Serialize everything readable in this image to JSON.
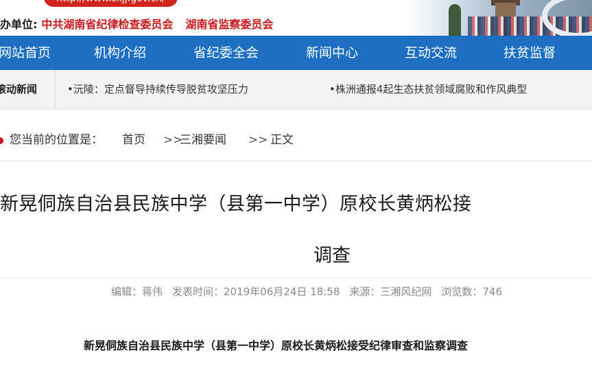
{
  "header": {
    "url": "http://www.sxjj.gov.cn/",
    "sponsor_label": "办单位:",
    "org_1": "中共湖南省纪律检查委员会",
    "org_2": "湖南省监察委员会"
  },
  "nav": {
    "items": [
      {
        "label": "网站首页"
      },
      {
        "label": "机构介绍"
      },
      {
        "label": "省纪委全会"
      },
      {
        "label": "新闻中心"
      },
      {
        "label": "互动交流"
      },
      {
        "label": "扶贫监督"
      }
    ]
  },
  "ticker": {
    "label": "滚动新闻",
    "items": [
      {
        "text": "•沅陵：定点督导持续传导脱贫攻坚压力"
      },
      {
        "text": "•株洲通报4起生态扶贫领域腐败和作风典型"
      }
    ]
  },
  "breadcrumb": {
    "prefix": "您当前的位置是：",
    "home": "首页",
    "sep": ">>",
    "section": "三湘要闻",
    "current": "正文"
  },
  "article": {
    "title_line1": "新晃侗族自治县民族中学（县第一中学）原校长黄炳松接",
    "title_line2": "调查",
    "meta": {
      "editor": "编辑：蒋伟",
      "published": "发表时间：2019年06月24日 18:58",
      "source": "来源：三湘风纪网",
      "views": "浏览数：746"
    },
    "subheading": "新晃侗族自治县民族中学（县第一中学）原校长黄炳松接受纪律审查和监察调查"
  }
}
